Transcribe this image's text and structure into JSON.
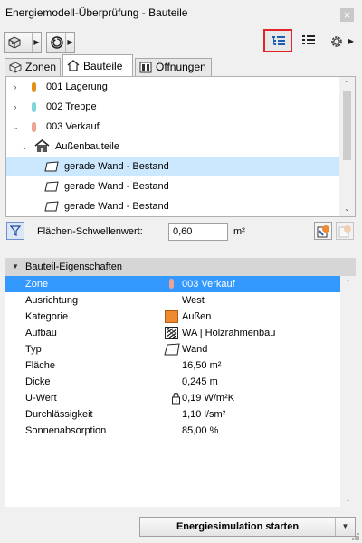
{
  "window": {
    "title": "Energiemodell-Überprüfung - Bauteile",
    "close_glyph": "×"
  },
  "tabs": [
    {
      "label": "Zonen",
      "icon": "zones-icon"
    },
    {
      "label": "Bauteile",
      "icon": "house-icon",
      "active": true
    },
    {
      "label": "Öffnungen",
      "icon": "window-icon"
    }
  ],
  "tree": {
    "items": [
      {
        "label": "001 Lagerung",
        "color": "#e48e17"
      },
      {
        "label": "002 Treppe",
        "color": "#7dd6dd"
      },
      {
        "label": "003 Verkauf",
        "color": "#efa392"
      },
      {
        "label": "Außenbauteile"
      },
      {
        "label": "gerade Wand - Bestand"
      },
      {
        "label": "gerade Wand - Bestand"
      },
      {
        "label": "gerade Wand - Bestand"
      }
    ]
  },
  "threshold": {
    "label": "Flächen-Schwellenwert:",
    "value": "0,60",
    "unit": "m²"
  },
  "properties": {
    "header": "Bauteil-Eigenschaften",
    "rows": [
      {
        "name": "Zone",
        "value": "003 Verkauf"
      },
      {
        "name": "Ausrichtung",
        "value": "West"
      },
      {
        "name": "Kategorie",
        "value": "Außen"
      },
      {
        "name": "Aufbau",
        "value": "WA | Holzrahmenbau"
      },
      {
        "name": "Typ",
        "value": "Wand"
      },
      {
        "name": "Fläche",
        "value": "16,50 m²"
      },
      {
        "name": "Dicke",
        "value": "0,245 m"
      },
      {
        "name": "U-Wert",
        "value": "0,19 W/m²K"
      },
      {
        "name": "Durchlässigkeit",
        "value": "1,10 l/sm²"
      },
      {
        "name": "Sonnenabsorption",
        "value": "85,00 %"
      }
    ]
  },
  "footer": {
    "start_label": "Energiesimulation starten"
  },
  "colors": {
    "selection": "#cce8ff",
    "selected_row": "#3399ff",
    "category_swatch": "#f08a30",
    "highlight_border": "#e0242b"
  }
}
